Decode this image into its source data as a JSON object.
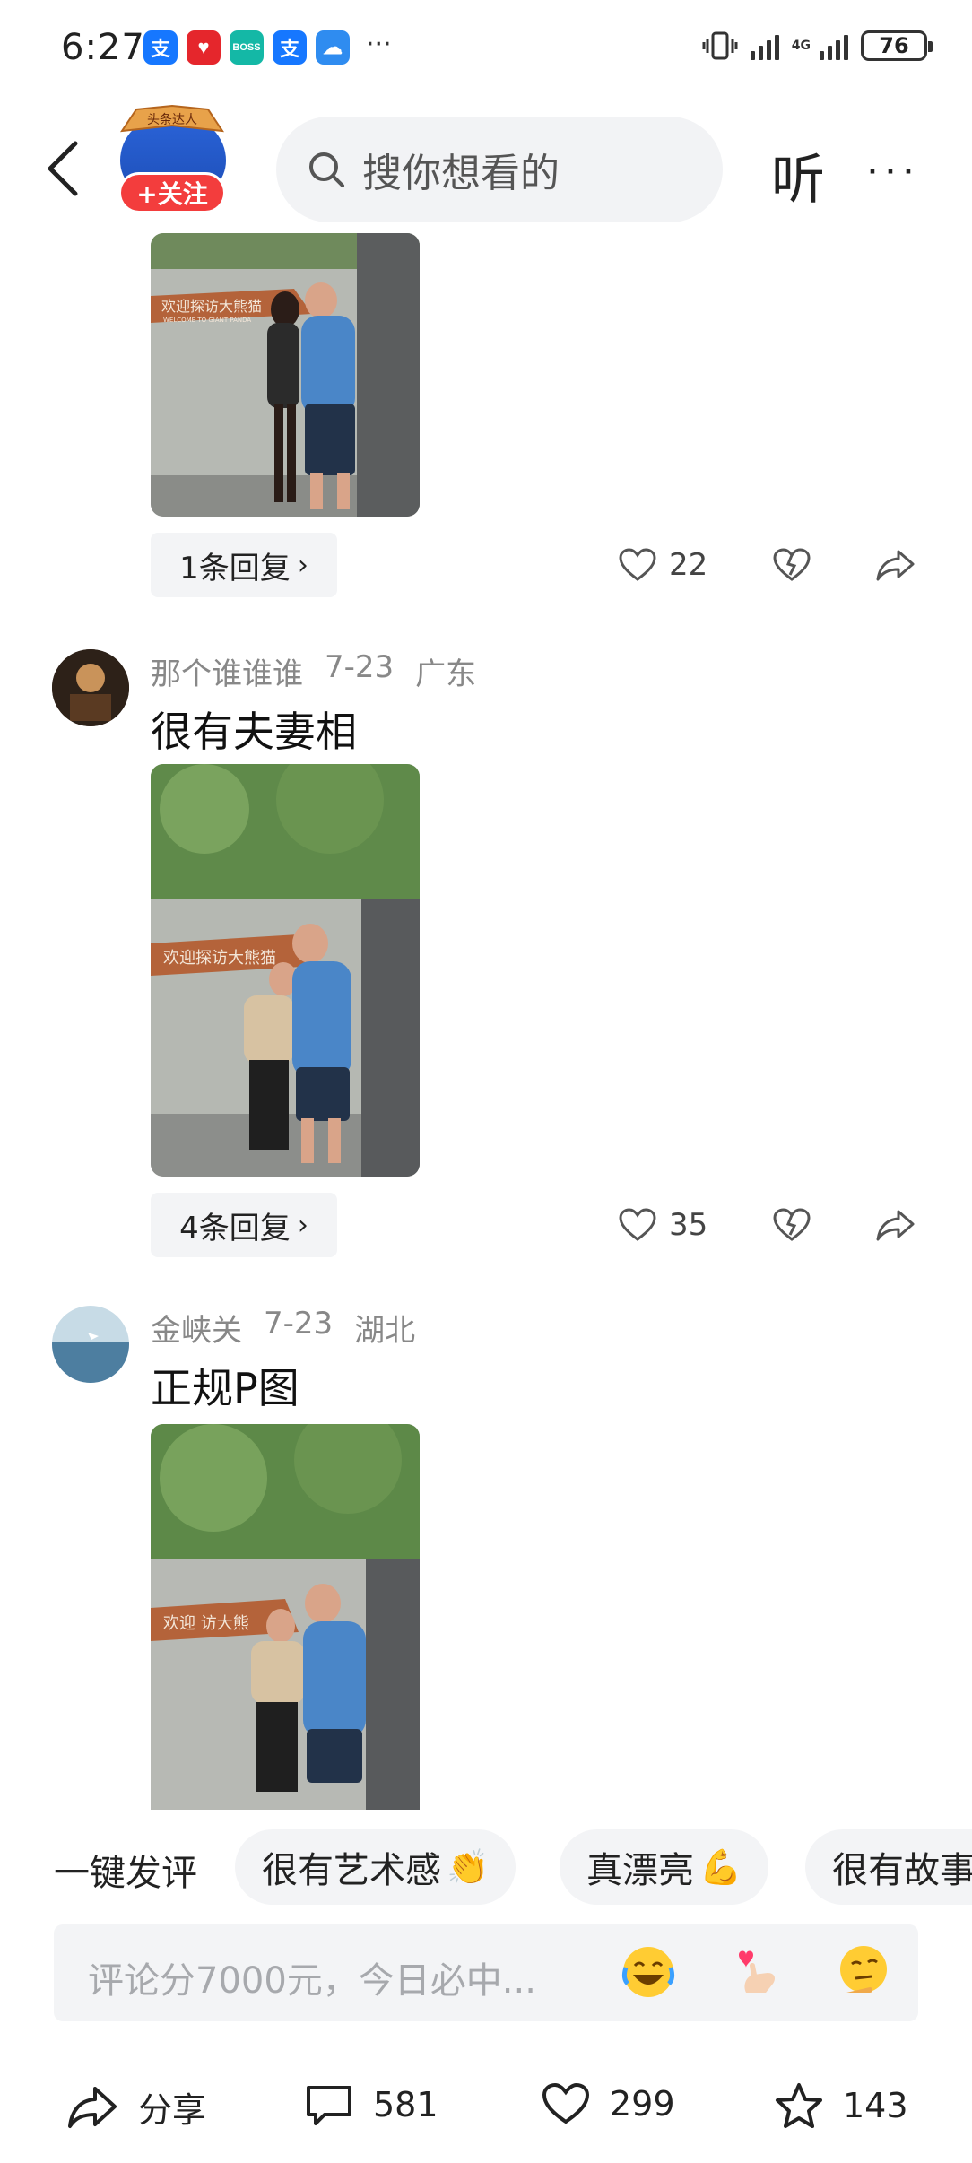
{
  "status_bar": {
    "time": "6:27",
    "app_icons": [
      {
        "label": "支",
        "color": "#1677ff"
      },
      {
        "label": "♥",
        "color": "#e5262c"
      },
      {
        "label": "BOSS",
        "color": "#14b8a6"
      },
      {
        "label": "支",
        "color": "#1677ff"
      },
      {
        "label": "☁",
        "color": "#2f8cf0"
      }
    ],
    "more_dots": "···",
    "network": "4G",
    "battery": "76"
  },
  "header": {
    "badge_text": "头条达人",
    "follow_label": "+关注",
    "search_placeholder": "搜你想看的",
    "listen_label": "听",
    "more_label": "···"
  },
  "comments": [
    {
      "reply_count": "1条回复",
      "likes": "22"
    },
    {
      "author": "那个谁谁谁",
      "date": "7-23",
      "region": "广东",
      "text": "很有夫妻相",
      "reply_count": "4条回复",
      "likes": "35"
    },
    {
      "author": "金峡关",
      "date": "7-23",
      "region": "湖北",
      "text": "正规P图"
    }
  ],
  "photo_sign": {
    "first": "欢迎探访大熊猫",
    "first_sub": "WELCOME TO GIANT PANDA",
    "second": "欢迎探访大熊猫",
    "third": "欢迎 访大熊"
  },
  "quick_reply": {
    "label": "一键发评",
    "chips": [
      "很有艺术感",
      "真漂亮",
      "很有故事"
    ]
  },
  "comment_input": {
    "placeholder": "评论分7000元，今日必中..."
  },
  "bottom_bar": {
    "share_label": "分享",
    "comments_count": "581",
    "likes_count": "299",
    "favorites_count": "143"
  }
}
